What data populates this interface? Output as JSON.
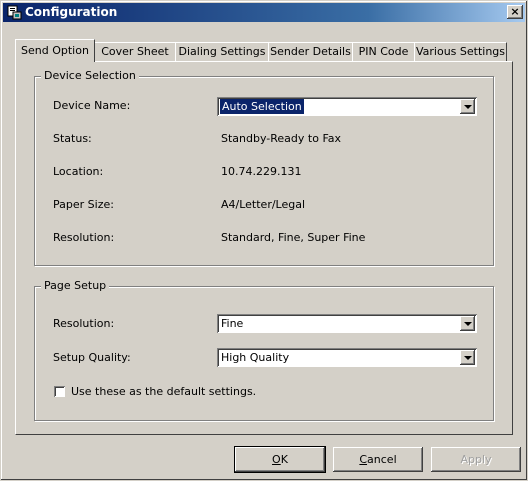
{
  "window": {
    "title": "Configuration",
    "close_glyph": "×",
    "icon": "app-config-icon"
  },
  "tabs": [
    {
      "label": "Send Option",
      "active": true
    },
    {
      "label": "Cover Sheet",
      "active": false
    },
    {
      "label": "Dialing Settings",
      "active": false
    },
    {
      "label": "Sender Details",
      "active": false
    },
    {
      "label": "PIN Code",
      "active": false
    },
    {
      "label": "Various Settings",
      "active": false
    }
  ],
  "device_selection": {
    "legend": "Device Selection",
    "device_name_label": "Device Name:",
    "device_name_value": "Auto Selection",
    "status_label": "Status:",
    "status_value": "Standby-Ready to Fax",
    "location_label": "Location:",
    "location_value": "10.74.229.131",
    "paper_size_label": "Paper Size:",
    "paper_size_value": "A4/Letter/Legal",
    "resolution_label": "Resolution:",
    "resolution_value": "Standard, Fine, Super Fine"
  },
  "page_setup": {
    "legend": "Page Setup",
    "resolution_label": "Resolution:",
    "resolution_value": "Fine",
    "setup_quality_label": "Setup Quality:",
    "setup_quality_value": "High Quality",
    "default_checkbox_label": "Use these as the default settings.",
    "default_checked": false
  },
  "buttons": {
    "ok_mnemonic": "O",
    "ok_rest": "K",
    "cancel_mnemonic": "C",
    "cancel_rest": "ancel",
    "apply_label": "Apply"
  }
}
